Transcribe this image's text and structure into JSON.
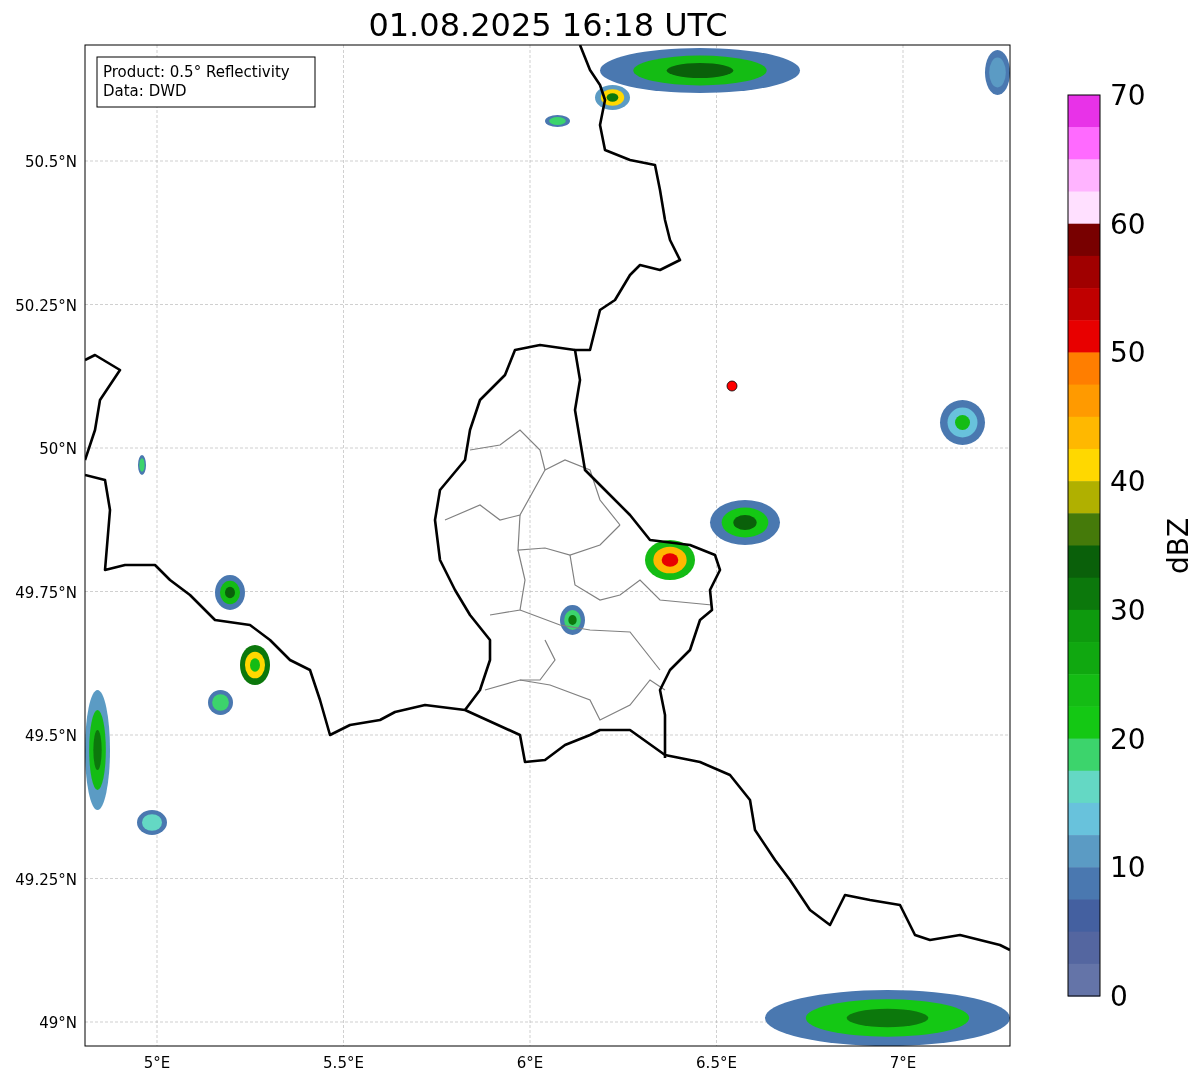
{
  "title": "01.08.2025 16:18 UTC",
  "info_box": [
    "Product: 0.5° Reflectivity",
    "Data: DWD"
  ],
  "map": {
    "lat_ticks": [
      "50.5°N",
      "50.25°N",
      "50°N",
      "49.75°N",
      "49.5°N",
      "49.25°N",
      "49°N"
    ],
    "lon_ticks": [
      "5°E",
      "5.5°E",
      "6°E",
      "6.5°E",
      "7°E"
    ]
  },
  "colorbar": {
    "label": "dBZ",
    "ticks": [
      "70",
      "60",
      "50",
      "40",
      "30",
      "20",
      "10",
      "0"
    ],
    "segments": [
      {
        "color": "#e832e8"
      },
      {
        "color": "#ff6aff"
      },
      {
        "color": "#ffb4ff"
      },
      {
        "color": "#ffe0ff"
      },
      {
        "color": "#780000"
      },
      {
        "color": "#a00000"
      },
      {
        "color": "#c00000"
      },
      {
        "color": "#e80000"
      },
      {
        "color": "#ff7e00"
      },
      {
        "color": "#ff9a00"
      },
      {
        "color": "#ffb800"
      },
      {
        "color": "#ffd800"
      },
      {
        "color": "#b0b000"
      },
      {
        "color": "#457a0a"
      },
      {
        "color": "#0a600a"
      },
      {
        "color": "#0c780c"
      },
      {
        "color": "#0e9a0e"
      },
      {
        "color": "#10a810"
      },
      {
        "color": "#14bc14"
      },
      {
        "color": "#14c814"
      },
      {
        "color": "#3cd46c"
      },
      {
        "color": "#64d8c4"
      },
      {
        "color": "#68c2dc"
      },
      {
        "color": "#5b9bc4"
      },
      {
        "color": "#4a78b0"
      },
      {
        "color": "#4460a0"
      },
      {
        "color": "#5466a0"
      },
      {
        "color": "#6474a8"
      }
    ]
  }
}
